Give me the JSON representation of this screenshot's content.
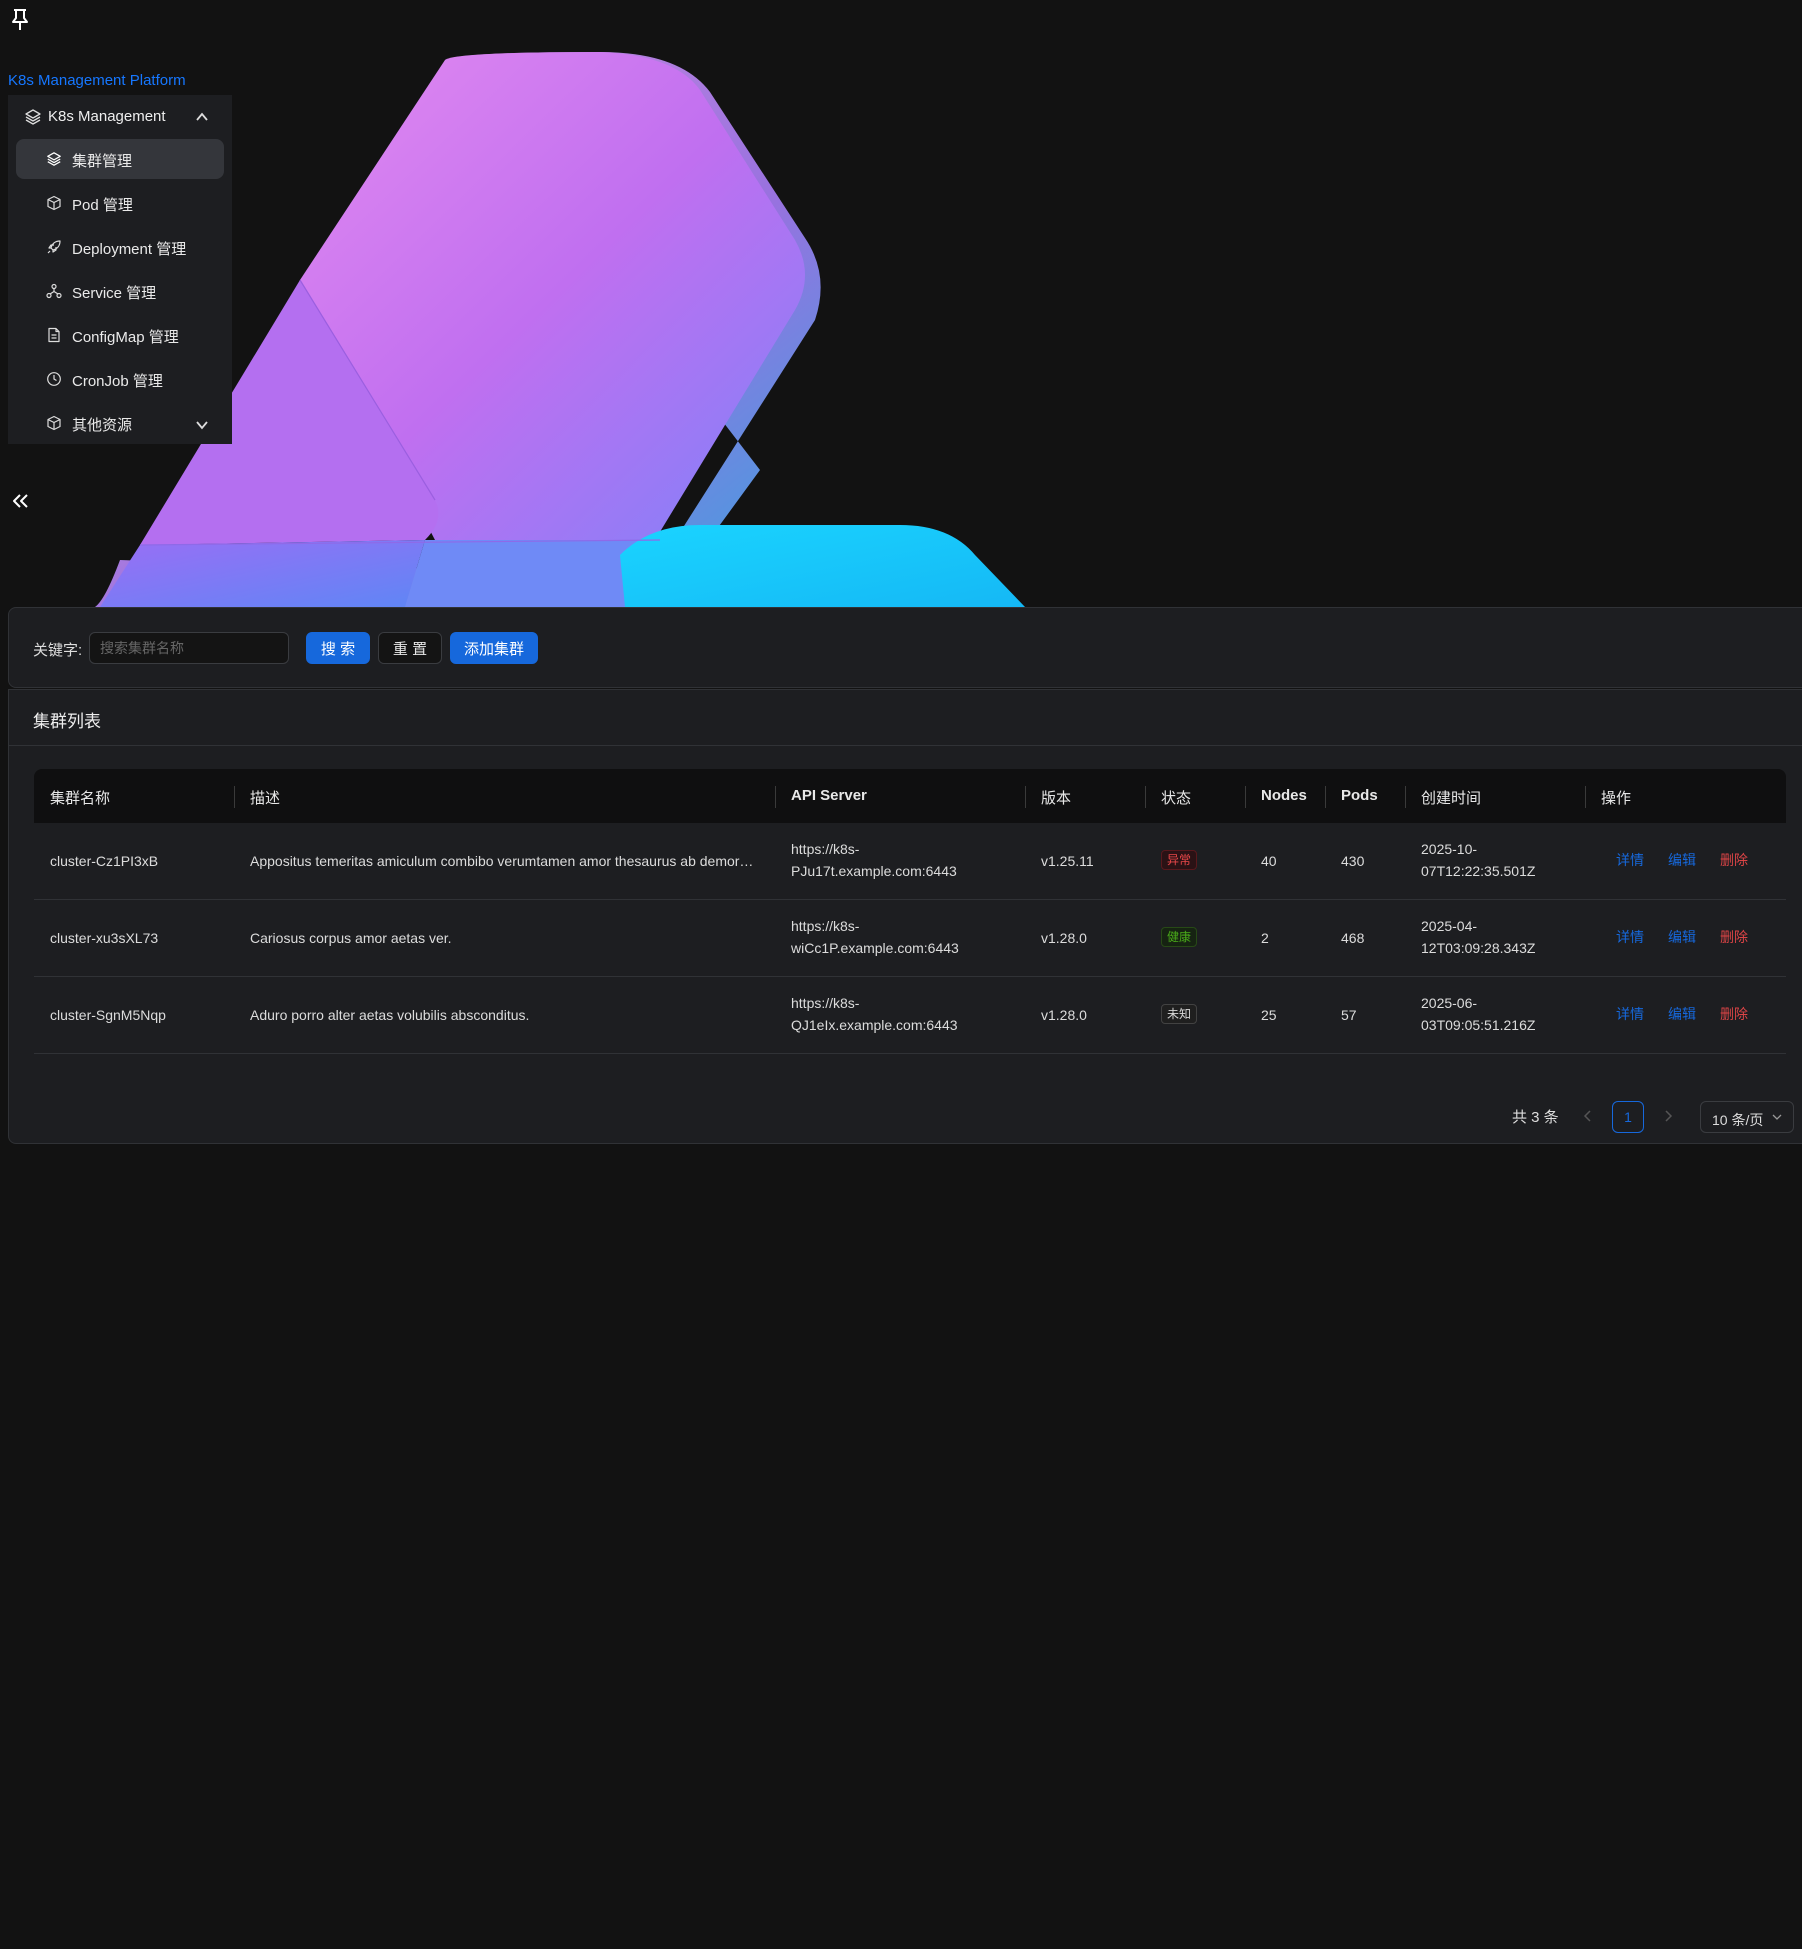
{
  "app": {
    "brand": "K8s Management Platform"
  },
  "sidebar": {
    "group": {
      "label": "K8s Management",
      "icon": "layers-icon"
    },
    "items": [
      {
        "label": "集群管理",
        "icon": "layers-icon",
        "active": true
      },
      {
        "label": "Pod 管理",
        "icon": "box-icon"
      },
      {
        "label": "Deployment 管理",
        "icon": "rocket-icon"
      },
      {
        "label": "Service 管理",
        "icon": "network-icon"
      },
      {
        "label": "ConfigMap 管理",
        "icon": "file-icon"
      },
      {
        "label": "CronJob 管理",
        "icon": "clock-icon"
      },
      {
        "label": "其他资源",
        "icon": "box-icon",
        "expandable": true
      }
    ]
  },
  "search": {
    "label": "关键字:",
    "placeholder": "搜索集群名称",
    "value": "",
    "search_button": "搜 索",
    "reset_button": "重 置",
    "add_button": "添加集群"
  },
  "list": {
    "title": "集群列表",
    "columns": [
      "集群名称",
      "描述",
      "API Server",
      "版本",
      "状态",
      "Nodes",
      "Pods",
      "创建时间",
      "操作"
    ],
    "rows": [
      {
        "name": "cluster-Cz1PI3xB",
        "description": "Appositus temeritas amiculum combibo verumtamen amor thesaurus ab demor…",
        "api_line1": "https://k8s-",
        "api_line2": "PJu17t.example.com:6443",
        "version": "v1.25.11",
        "status": "异常",
        "status_kind": "err",
        "nodes": "40",
        "pods": "430",
        "created_line1": "2025-10-",
        "created_line2": "07T12:22:35.501Z",
        "actions": [
          "详情",
          "编辑",
          "删除"
        ]
      },
      {
        "name": "cluster-xu3sXL73",
        "description": "Cariosus corpus amor aetas ver.",
        "api_line1": "https://k8s-",
        "api_line2": "wiCc1P.example.com:6443",
        "version": "v1.28.0",
        "status": "健康",
        "status_kind": "ok",
        "nodes": "2",
        "pods": "468",
        "created_line1": "2025-04-",
        "created_line2": "12T03:09:28.343Z",
        "actions": [
          "详情",
          "编辑",
          "删除"
        ]
      },
      {
        "name": "cluster-SgnM5Nqp",
        "description": "Aduro porro alter aetas volubilis absconditus.",
        "api_line1": "https://k8s-",
        "api_line2": "QJ1eIx.example.com:6443",
        "version": "v1.28.0",
        "status": "未知",
        "status_kind": "unk",
        "nodes": "25",
        "pods": "57",
        "created_line1": "2025-06-",
        "created_line2": "03T09:05:51.216Z",
        "actions": [
          "详情",
          "编辑",
          "删除"
        ]
      }
    ],
    "pagination": {
      "total": "共 3 条",
      "current": "1",
      "page_size": "10 条/页"
    }
  },
  "colors": {
    "accent": "#1668dc",
    "danger": "#dc4446",
    "background": "#121212",
    "panel": "#1d1e21"
  }
}
